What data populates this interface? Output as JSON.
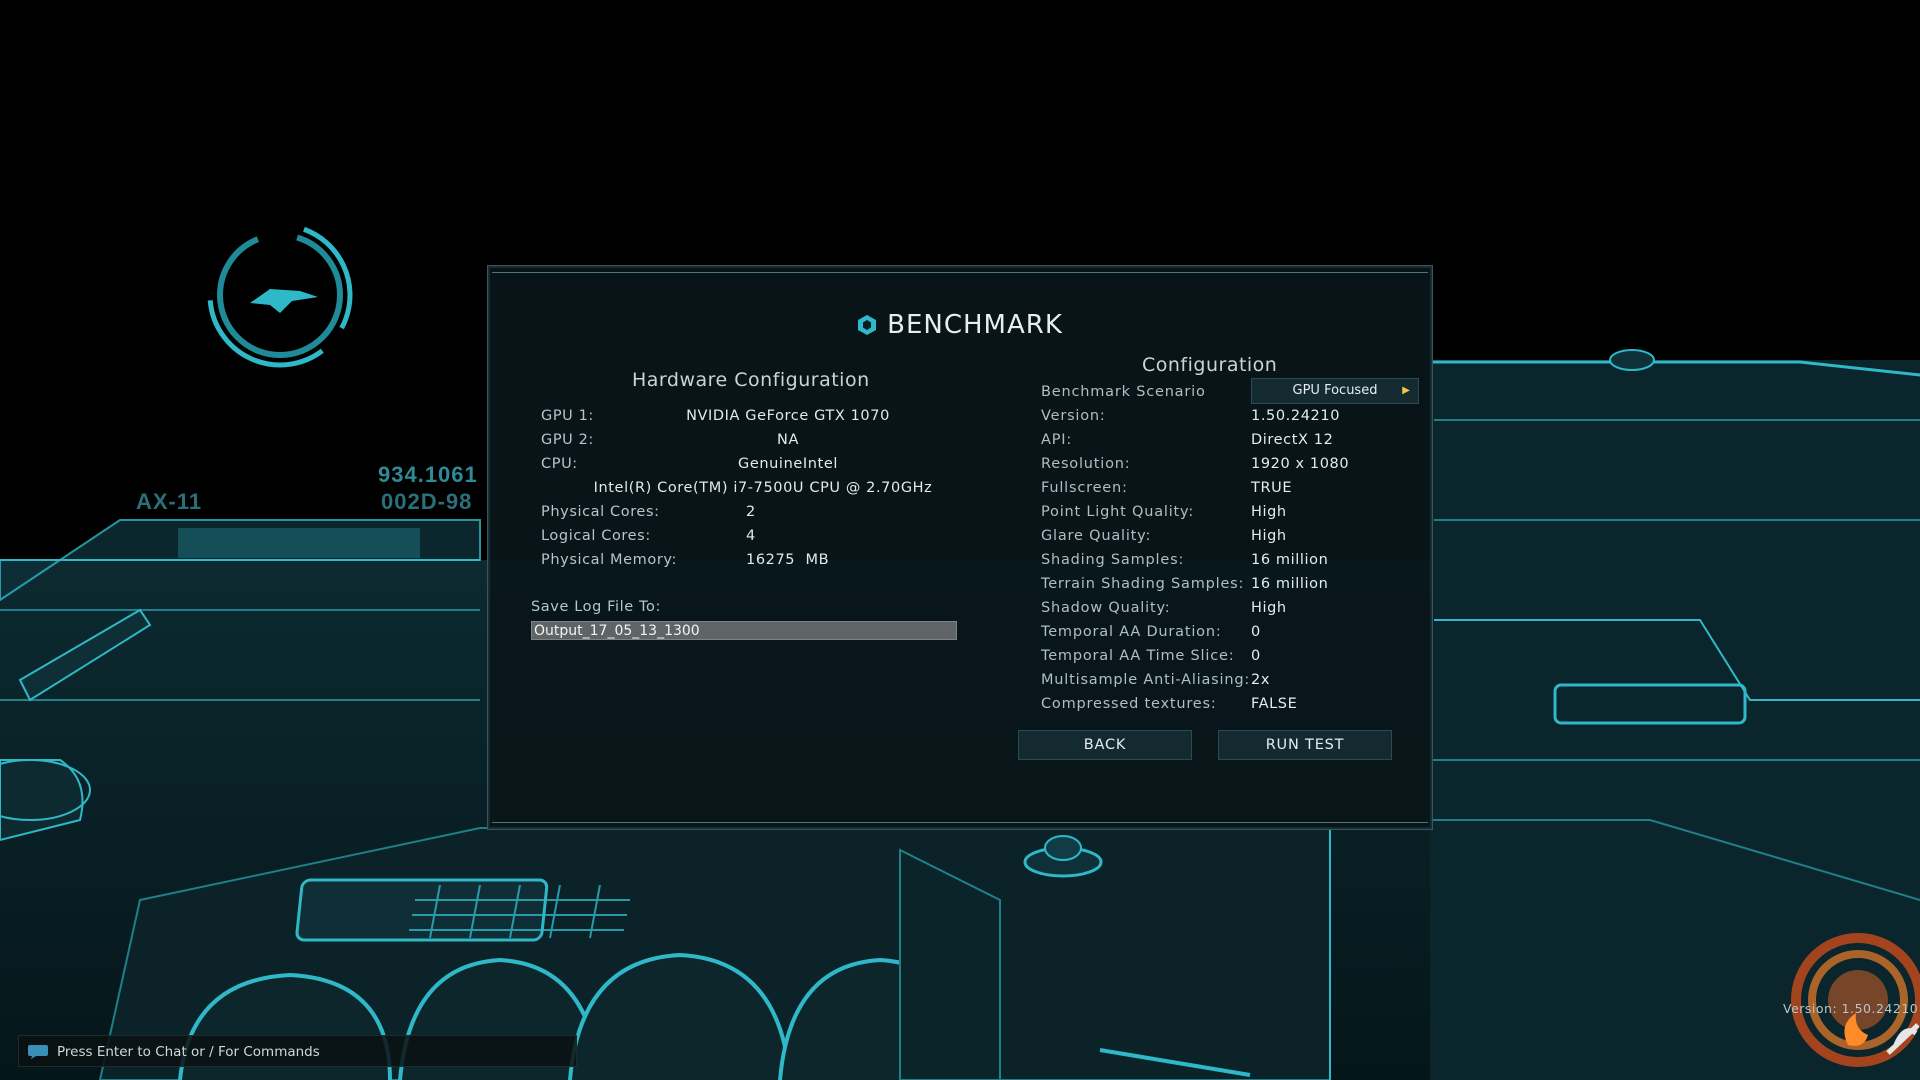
{
  "background": {
    "labels": [
      "AX-11",
      "934.1061",
      "002D-98"
    ]
  },
  "dialog": {
    "title": "BENCHMARK",
    "hardware": {
      "heading": "Hardware Configuration",
      "rows": [
        {
          "label": "GPU 1:",
          "value": "NVIDIA GeForce GTX 1070"
        },
        {
          "label": "GPU 2:",
          "value": "NA"
        },
        {
          "label": "CPU:",
          "value": "GenuineIntel"
        },
        {
          "label": "",
          "value": "Intel(R) Core(TM) i7-7500U CPU @ 2.70GHz"
        },
        {
          "label": "Physical Cores:",
          "value": "2"
        },
        {
          "label": "Logical Cores:",
          "value": "4"
        },
        {
          "label": "Physical Memory:",
          "value": "16275  MB"
        }
      ],
      "save_log_label": "Save Log File To:",
      "save_log_value": "Output_17_05_13_1300"
    },
    "configuration": {
      "heading": "Configuration",
      "scenario_label": "Benchmark Scenario",
      "scenario_value": "GPU Focused",
      "rows": [
        {
          "label": "Version:",
          "value": "1.50.24210"
        },
        {
          "label": "API:",
          "value": "DirectX 12"
        },
        {
          "label": "Resolution:",
          "value": "1920 x 1080"
        },
        {
          "label": "Fullscreen:",
          "value": "TRUE"
        },
        {
          "label": "Point Light Quality:",
          "value": "High"
        },
        {
          "label": "Glare Quality:",
          "value": "High"
        },
        {
          "label": "Shading Samples:",
          "value": "16 million"
        },
        {
          "label": "Terrain Shading Samples:",
          "value": "16 million"
        },
        {
          "label": "Shadow Quality:",
          "value": "High"
        },
        {
          "label": "Temporal AA Duration:",
          "value": "0"
        },
        {
          "label": "Temporal AA Time Slice:",
          "value": "0"
        },
        {
          "label": "Multisample Anti-Aliasing:",
          "value": "2x"
        },
        {
          "label": "Compressed textures:",
          "value": "FALSE"
        }
      ]
    },
    "buttons": {
      "back": "BACK",
      "run_test": "RUN TEST"
    }
  },
  "chat": {
    "text": "Press Enter to Chat or / For Commands"
  },
  "watermark": {
    "version": "Version: 1.50.24210"
  },
  "colors": {
    "accent_cyan": "#2fb8c8",
    "dialog_bg": "#09161a",
    "arrow_yellow": "#f2c744"
  }
}
